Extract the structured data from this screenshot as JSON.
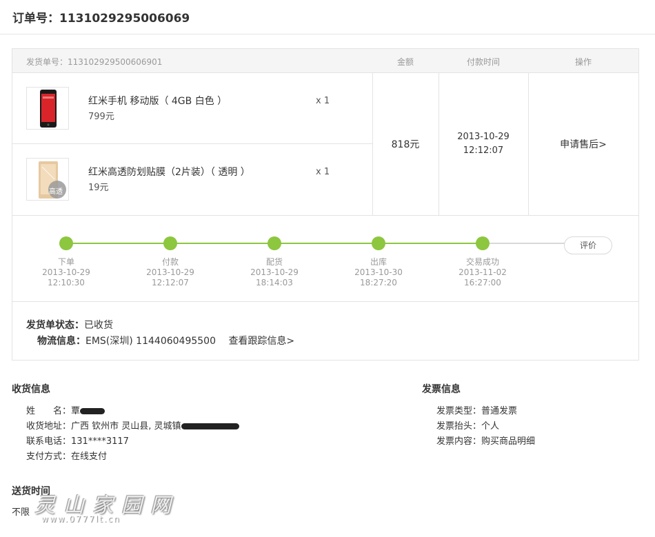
{
  "order": {
    "label": "订单号：",
    "number": "1131029295006069"
  },
  "table": {
    "ship_no_label": "发货单号：1131029295006069​01",
    "col_amount": "金额",
    "col_paytime": "付款时间",
    "col_action": "操作",
    "amount": "818元",
    "pay_date": "2013-10-29",
    "pay_time": "12:12:07",
    "action": "申请售后>",
    "products": [
      {
        "name": "红米手机 移动版（ 4GB 白色 ）",
        "price": "799元",
        "qty": "x 1",
        "image": "phone-red"
      },
      {
        "name": "红米高透防划贴膜（2片装）（ 透明 ）",
        "price": "19元",
        "qty": "x 1",
        "image": "screen-film",
        "badge": "高透"
      }
    ]
  },
  "progress": {
    "steps": [
      {
        "label": "下单",
        "date": "2013-10-29",
        "time": "12:10:30"
      },
      {
        "label": "付款",
        "date": "2013-10-29",
        "time": "12:12:07"
      },
      {
        "label": "配货",
        "date": "2013-10-29",
        "time": "18:14:03"
      },
      {
        "label": "出库",
        "date": "2013-10-30",
        "time": "18:27:20"
      },
      {
        "label": "交易成功",
        "date": "2013-11-02",
        "time": "16:27:00"
      }
    ],
    "review_label": "评价",
    "accent_color": "#8dc63f"
  },
  "shipping": {
    "status_label": "发货单状态：",
    "status_value": "已收货",
    "logistics_label": "物流信息：",
    "logistics_value": "EMS(深圳) 1144060495500",
    "tracking_link": "查看跟踪信息>"
  },
  "receiver": {
    "title": "收货信息",
    "name_label": "姓　　名：",
    "name_value": "覃",
    "address_label": "收货地址：",
    "address_value": "广西 钦州市 灵山县, 灵城镇",
    "phone_label": "联系电话：",
    "phone_value": "131****3117",
    "payment_label": "支付方式：",
    "payment_value": "在线支付"
  },
  "invoice": {
    "title": "发票信息",
    "type_label": "发票类型：",
    "type_value": "普通发票",
    "head_label": "发票抬头：",
    "head_value": "个人",
    "content_label": "发票内容：",
    "content_value": "购买商品明细"
  },
  "delivery": {
    "title": "送货时间",
    "value": "不限"
  },
  "watermark": {
    "text": "灵山家园网",
    "url": "www.0777lt.cn"
  }
}
